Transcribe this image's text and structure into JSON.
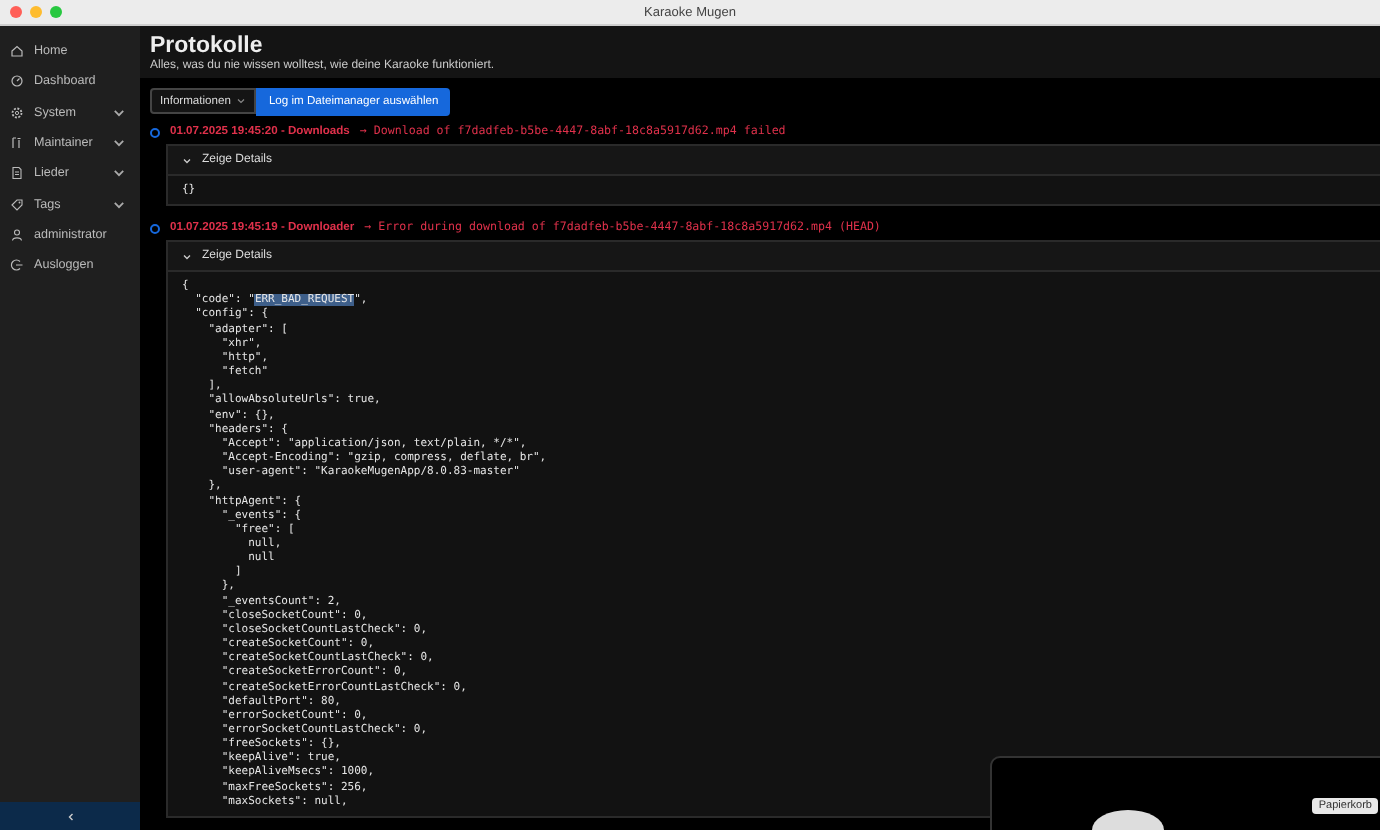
{
  "window": {
    "title": "Karaoke Mugen"
  },
  "sidebar": {
    "items": [
      {
        "label": "Home",
        "expandable": false
      },
      {
        "label": "Dashboard",
        "expandable": false
      },
      {
        "label": "System",
        "expandable": true
      },
      {
        "label": "Maintainer",
        "expandable": true
      },
      {
        "label": "Lieder",
        "expandable": true
      },
      {
        "label": "Tags",
        "expandable": true
      },
      {
        "label": "administrator",
        "expandable": false
      },
      {
        "label": "Ausloggen",
        "expandable": false
      }
    ]
  },
  "header": {
    "title": "Protokolle",
    "subtitle": "Alles, was du nie wissen wolltest, wie deine Karaoke funktioniert."
  },
  "toolbar": {
    "level_select": "Informationen",
    "open_button": "Log im Dateimanager auswählen"
  },
  "entries": [
    {
      "source": "01.07.2025 19:45:20 - Downloads",
      "message": "→ Download of f7dadfeb-b5be-4447-8abf-18c8a5917d62.mp4 failed",
      "details_label": "Zeige Details",
      "expanded": true,
      "lines": [
        "{}"
      ]
    },
    {
      "source": "01.07.2025 19:45:19 - Downloader",
      "message": "→ Error during download of f7dadfeb-b5be-4447-8abf-18c8a5917d62.mp4 (HEAD)",
      "details_label": "Zeige Details",
      "expanded": true,
      "lines": [
        "{",
        [
          {
            "text": "  \"code\": \"",
            "selected": false
          },
          {
            "text": "ERR_BAD_REQUEST",
            "selected": true
          },
          {
            "text": "\",",
            "selected": false
          }
        ],
        "  \"config\": {",
        "    \"adapter\": [",
        "      \"xhr\",",
        "      \"http\",",
        "      \"fetch\"",
        "    ],",
        "    \"allowAbsoluteUrls\": true,",
        "    \"env\": {},",
        "    \"headers\": {",
        "      \"Accept\": \"application/json, text/plain, */*\",",
        "      \"Accept-Encoding\": \"gzip, compress, deflate, br\",",
        "      \"user-agent\": \"KaraokeMugenApp/8.0.83-master\"",
        "    },",
        "    \"httpAgent\": {",
        "      \"_events\": {",
        "        \"free\": [",
        "          null,",
        "          null",
        "        ]",
        "      },",
        "      \"_eventsCount\": 2,",
        "      \"closeSocketCount\": 0,",
        "      \"closeSocketCountLastCheck\": 0,",
        "      \"createSocketCount\": 0,",
        "      \"createSocketCountLastCheck\": 0,",
        "      \"createSocketErrorCount\": 0,",
        "      \"createSocketErrorCountLastCheck\": 0,",
        "      \"defaultPort\": 80,",
        "      \"errorSocketCount\": 0,",
        "      \"errorSocketCountLastCheck\": 0,",
        "      \"freeSockets\": {},",
        "      \"keepAlive\": true,",
        "      \"keepAliveMsecs\": 1000,",
        "      \"maxFreeSockets\": 256,",
        "      \"maxSockets\": null,"
      ]
    }
  ],
  "overlay": {
    "tooltip": "Papierkorb"
  }
}
